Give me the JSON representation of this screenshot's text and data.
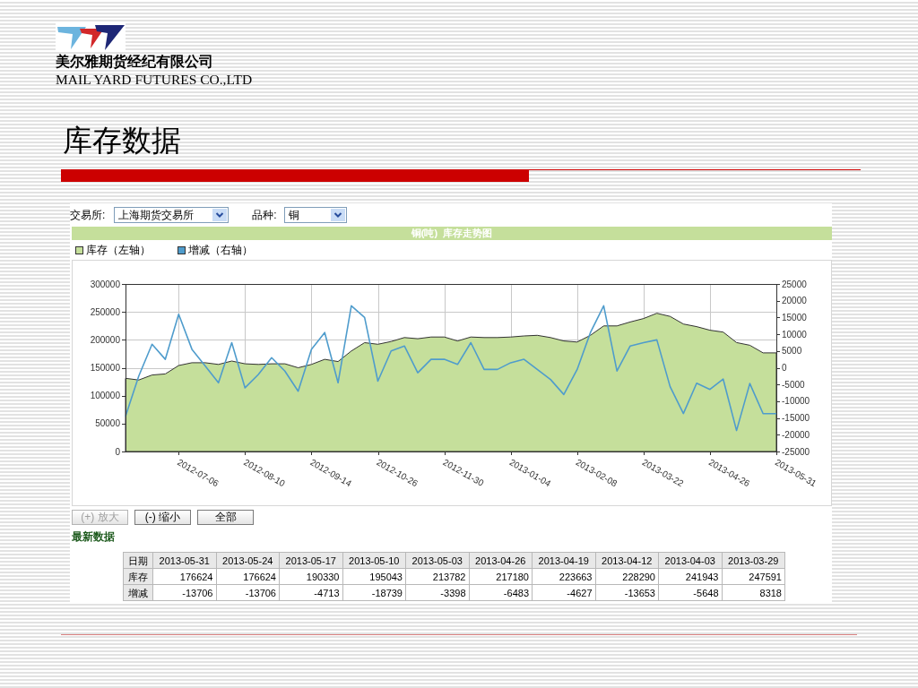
{
  "header": {
    "company_cn": "美尔雅期货经纪有限公司",
    "company_en": "MAIL YARD FUTURES CO.,LTD"
  },
  "slide_title": "库存数据",
  "filters": [
    {
      "label": "交易所:",
      "value": "上海期货交易所"
    },
    {
      "label": "品种:",
      "value": "铜"
    }
  ],
  "chart": {
    "chart_data": {
      "type": "area",
      "title": "铜(吨)  库存走势图",
      "legend": "top",
      "grid": true,
      "categories": [
        null,
        null,
        null,
        null,
        "2012-07-06",
        null,
        null,
        null,
        null,
        "2012-08-10",
        null,
        null,
        null,
        null,
        "2012-09-14",
        null,
        null,
        null,
        null,
        "2012-10-26",
        null,
        null,
        null,
        null,
        "2012-11-30",
        null,
        null,
        null,
        null,
        "2013-01-04",
        null,
        null,
        null,
        null,
        "2013-02-08",
        null,
        null,
        null,
        null,
        "2013-03-22",
        null,
        null,
        null,
        null,
        "2013-04-26",
        null,
        null,
        null,
        null,
        "2013-05-31"
      ],
      "ylim": [
        0,
        300000
      ],
      "yticks": [
        0,
        50000,
        100000,
        150000,
        200000,
        250000,
        300000
      ],
      "y2lim": [
        -25000,
        25000
      ],
      "y2ticks": [
        -25000,
        -20000,
        -15000,
        -10000,
        -5000,
        0,
        5000,
        10000,
        15000,
        20000,
        25000
      ],
      "series": [
        {
          "name": "库存（左轴）",
          "color": "#c5df9b",
          "values": [
            131000,
            128000,
            137000,
            139000,
            154000,
            159000,
            159000,
            156000,
            162000,
            157000,
            156000,
            157000,
            157000,
            150000,
            156000,
            165000,
            161000,
            180000,
            195000,
            192000,
            197000,
            204000,
            202000,
            205000,
            205000,
            198000,
            205000,
            204000,
            204000,
            205000,
            207000,
            208000,
            204000,
            198000,
            196000,
            208000,
            225000,
            225000,
            232000,
            238000,
            247591,
            241943,
            228290,
            223663,
            217180,
            213782,
            195043,
            190330,
            176624,
            176624
          ]
        },
        {
          "name": "增减（右轴）",
          "type": "line",
          "axis": "y2",
          "color": "#4f9ccc",
          "values": [
            -14500,
            -2500,
            7000,
            2500,
            16000,
            5500,
            500,
            -4500,
            7500,
            -6000,
            -2000,
            3000,
            -1000,
            -7000,
            5500,
            10500,
            -4500,
            18500,
            15000,
            -4000,
            5000,
            6500,
            -1500,
            2500,
            2500,
            1000,
            7500,
            -500,
            -500,
            1500,
            2500,
            -500,
            -3500,
            -8000,
            -500,
            10500,
            18500,
            -1000,
            6500,
            7500,
            8318,
            -5648,
            -13653,
            -4627,
            -6483,
            -3398,
            -18739,
            -4713,
            -13706,
            -13706
          ]
        }
      ]
    }
  },
  "buttons": [
    {
      "label": "(+) 放大",
      "disabled": true
    },
    {
      "label": "(-) 缩小",
      "disabled": false
    },
    {
      "label": "全部",
      "disabled": false
    }
  ],
  "latest_data": {
    "title": "最新数据",
    "columns": [
      "日期",
      "2013-05-31",
      "2013-05-24",
      "2013-05-17",
      "2013-05-10",
      "2013-05-03",
      "2013-04-26",
      "2013-04-19",
      "2013-04-12",
      "2013-04-03",
      "2013-03-29"
    ],
    "rows": [
      [
        "库存",
        "176624",
        "176624",
        "190330",
        "195043",
        "213782",
        "217180",
        "223663",
        "228290",
        "241943",
        "247591"
      ],
      [
        "增减",
        "-13706",
        "-13706",
        "-4713",
        "-18739",
        "-3398",
        "-6483",
        "-4627",
        "-13653",
        "-5648",
        "8318"
      ]
    ]
  }
}
